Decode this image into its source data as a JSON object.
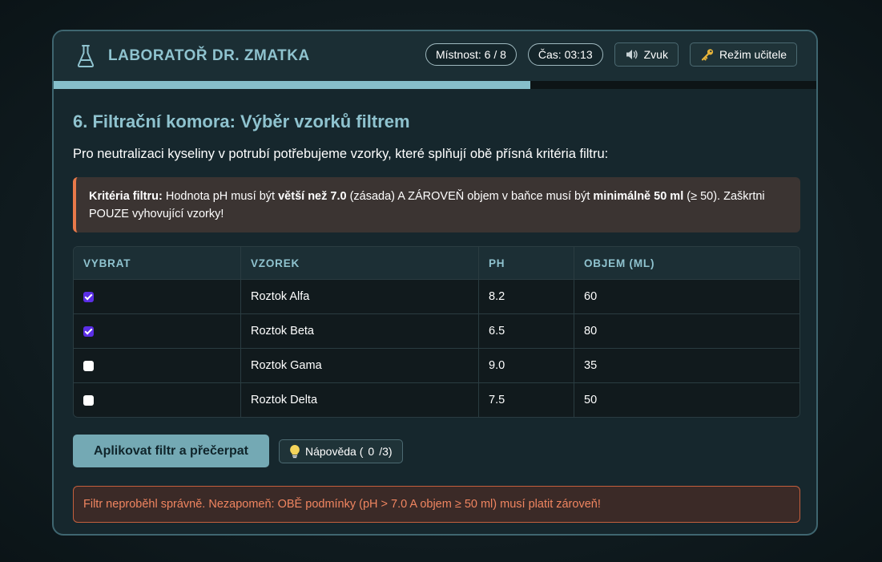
{
  "header": {
    "title": "LABORATOŘ DR. ZMATKA",
    "room": "Místnost: 6 / 8",
    "time": "Čas: 03:13",
    "sound_label": "Zvuk",
    "teacher_label": "Režim učitele"
  },
  "progress": {
    "fraction": 0.625
  },
  "level": {
    "title": "6. Filtrační komora: Výběr vzorků filtrem",
    "intro": "Pro neutralizaci kyseliny v potrubí potřebujeme vzorky, které splňují obě přísná kritéria filtru:",
    "criteria": {
      "label": "Kritéria filtru:",
      "t1": " Hodnota pH musí být ",
      "b1": "větší než 7.0",
      "t2": " (zásada) A ZÁROVEŇ objem v baňce musí být ",
      "b2": "minimálně 50 ml",
      "t3": " (≥ 50). Zaškrtni POUZE vyhovující vzorky!"
    }
  },
  "table": {
    "headers": [
      "VYBRAT",
      "VZOREK",
      "PH",
      "OBJEM (ML)"
    ],
    "rows": [
      {
        "name": "Roztok Alfa",
        "ph": "8.2",
        "volume": "60",
        "checked": true
      },
      {
        "name": "Roztok Beta",
        "ph": "6.5",
        "volume": "80",
        "checked": true
      },
      {
        "name": "Roztok Gama",
        "ph": "9.0",
        "volume": "35",
        "checked": false
      },
      {
        "name": "Roztok Delta",
        "ph": "7.5",
        "volume": "50",
        "checked": false
      }
    ]
  },
  "actions": {
    "apply_label": "Aplikovat filtr a přečerpat",
    "hint_label": "Nápověda (",
    "hint_count": "0",
    "hint_suffix": "/3)"
  },
  "error": "Filtr neproběhl správně. Nezapomeň: OBĚ podmínky (pH > 7.0 A objem ≥ 50 ml) musí platit zároveň!",
  "colors": {
    "accent": "#8fc3cf",
    "checkbox_on": "#5b2ee6",
    "warning": "#e8794a",
    "error_text": "#f08560"
  },
  "icons": {
    "logo": "flask-icon",
    "sound": "speaker-icon",
    "teacher": "key-icon",
    "hint": "lightbulb-icon"
  }
}
